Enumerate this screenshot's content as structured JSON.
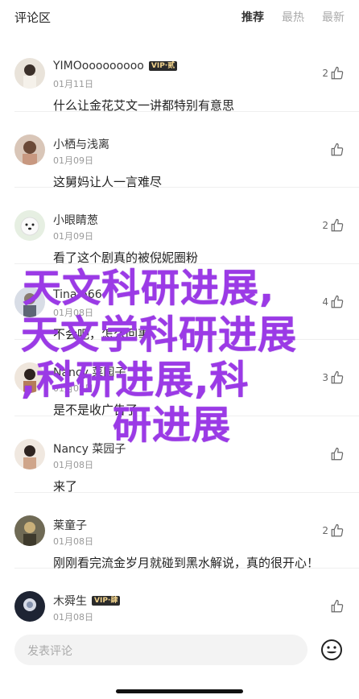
{
  "header": {
    "title": "评论区",
    "tabs": [
      {
        "label": "推荐",
        "active": true
      },
      {
        "label": "最热",
        "active": false
      },
      {
        "label": "最新",
        "active": false
      }
    ]
  },
  "comments": [
    {
      "name": "YIMOooooooooo",
      "vip": "VIP·贰",
      "date": "01月11日",
      "content": "什么让金花艾文一讲都特别有意思",
      "likes": "2"
    },
    {
      "name": "小栖与浅离",
      "vip": "",
      "date": "01月09日",
      "content": "这舅妈让人一言难尽",
      "likes": ""
    },
    {
      "name": "小眼睛葱",
      "vip": "",
      "date": "01月09日",
      "content": "看了这个剧真的被倪妮圈粉",
      "likes": "2"
    },
    {
      "name": "Tina 666",
      "vip": "",
      "date": "01月08日",
      "content": "不会吧，怎么回事",
      "likes": "4"
    },
    {
      "name": "Nancy 菜园子",
      "vip": "",
      "date": "01月08日",
      "content": "是不是收广告了",
      "likes": "3"
    },
    {
      "name": "Nancy 菜园子",
      "vip": "",
      "date": "01月08日",
      "content": "来了",
      "likes": ""
    },
    {
      "name": "莱童子",
      "vip": "",
      "date": "01月08日",
      "content": "刚刚看完流金岁月就碰到黑水解说，真的很开心！",
      "likes": "2"
    },
    {
      "name": "木舜生",
      "vip": "VIP·肆",
      "date": "01月08日",
      "content": "",
      "likes": ""
    }
  ],
  "overlay": {
    "lines": [
      "天文科研进展,",
      "天文学科研进展",
      ",科研进展,科",
      "研进展"
    ]
  },
  "footer": {
    "placeholder": "发表评论",
    "emoji_icon": "smiley-icon"
  },
  "colors": {
    "overlay_text": "#9b3ae6",
    "vip_bg": "#2b2b2b",
    "vip_text": "#f0d28c"
  }
}
